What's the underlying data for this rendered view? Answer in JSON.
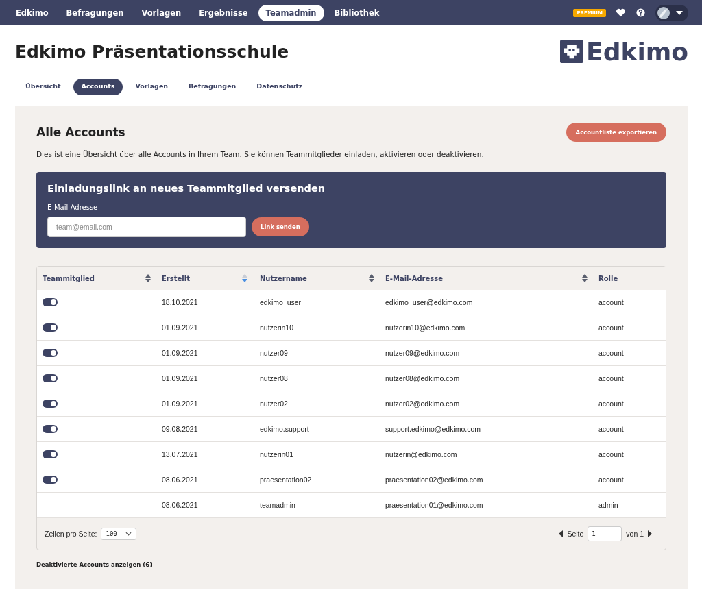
{
  "topnav": {
    "items": [
      {
        "label": "Edkimo",
        "selected": false
      },
      {
        "label": "Befragungen",
        "selected": false
      },
      {
        "label": "Vorlagen",
        "selected": false
      },
      {
        "label": "Ergebnisse",
        "selected": false
      },
      {
        "label": "Teamadmin",
        "selected": true
      },
      {
        "label": "Bibliothek",
        "selected": false
      }
    ],
    "badge": "PREMIUM"
  },
  "page_title": "Edkimo Präsentationsschule",
  "logo": "Edkimo",
  "subtabs": [
    {
      "label": "Übersicht",
      "selected": false
    },
    {
      "label": "Accounts",
      "selected": true
    },
    {
      "label": "Vorlagen",
      "selected": false
    },
    {
      "label": "Befragungen",
      "selected": false
    },
    {
      "label": "Datenschutz",
      "selected": false
    }
  ],
  "section": {
    "title": "Alle Accounts",
    "export_button": "Accountliste exportieren",
    "description": "Dies ist eine Übersicht über alle Accounts in Ihrem Team. Sie können Teammitglieder einladen, aktivieren oder deaktivieren."
  },
  "invite": {
    "title": "Einladungslink an neues Teammitglied versenden",
    "label": "E-Mail-Adresse",
    "placeholder": "team@email.com",
    "button": "Link senden"
  },
  "table": {
    "columns": [
      {
        "label": "Teammitglied",
        "sortable": true,
        "sorted": false
      },
      {
        "label": "Erstellt",
        "sortable": true,
        "sorted": true
      },
      {
        "label": "Nutzername",
        "sortable": true,
        "sorted": false
      },
      {
        "label": "E-Mail-Adresse",
        "sortable": true,
        "sorted": false
      },
      {
        "label": "Rolle",
        "sortable": false
      }
    ],
    "rows": [
      {
        "kind": "member",
        "active": true,
        "created": "18.10.2021",
        "username": "edkimo_user",
        "email": "edkimo_user@edkimo.com",
        "role": "account"
      },
      {
        "kind": "member",
        "active": true,
        "created": "01.09.2021",
        "username": "nutzerin10",
        "email": "nutzerin10@edkimo.com",
        "role": "account"
      },
      {
        "kind": "member",
        "active": true,
        "created": "01.09.2021",
        "username": "nutzer09",
        "email": "nutzer09@edkimo.com",
        "role": "account"
      },
      {
        "kind": "member",
        "active": true,
        "created": "01.09.2021",
        "username": "nutzer08",
        "email": "nutzer08@edkimo.com",
        "role": "account"
      },
      {
        "kind": "member",
        "active": true,
        "created": "01.09.2021",
        "username": "nutzer02",
        "email": "nutzer02@edkimo.com",
        "role": "account"
      },
      {
        "kind": "member",
        "active": true,
        "created": "09.08.2021",
        "username": "edkimo.support",
        "email": "support.edkimo@edkimo.com",
        "role": "account"
      },
      {
        "kind": "member",
        "active": true,
        "created": "13.07.2021",
        "username": "nutzerin01",
        "email": "nutzerin@edkimo.com",
        "role": "account"
      },
      {
        "kind": "member",
        "active": true,
        "created": "08.06.2021",
        "username": "praesentation02",
        "email": "praesentation02@edkimo.com",
        "role": "account"
      },
      {
        "kind": "admin",
        "created": "08.06.2021",
        "username": "teamadmin",
        "email": "praesentation01@edkimo.com",
        "role": "admin"
      }
    ],
    "rows_label": "Zeilen pro Seite:",
    "rows_per_page": "100",
    "page_label": "Seite",
    "page": "1",
    "page_total": "von 1"
  },
  "deactivated_link": "Deaktivierte Accounts anzeigen (6)"
}
